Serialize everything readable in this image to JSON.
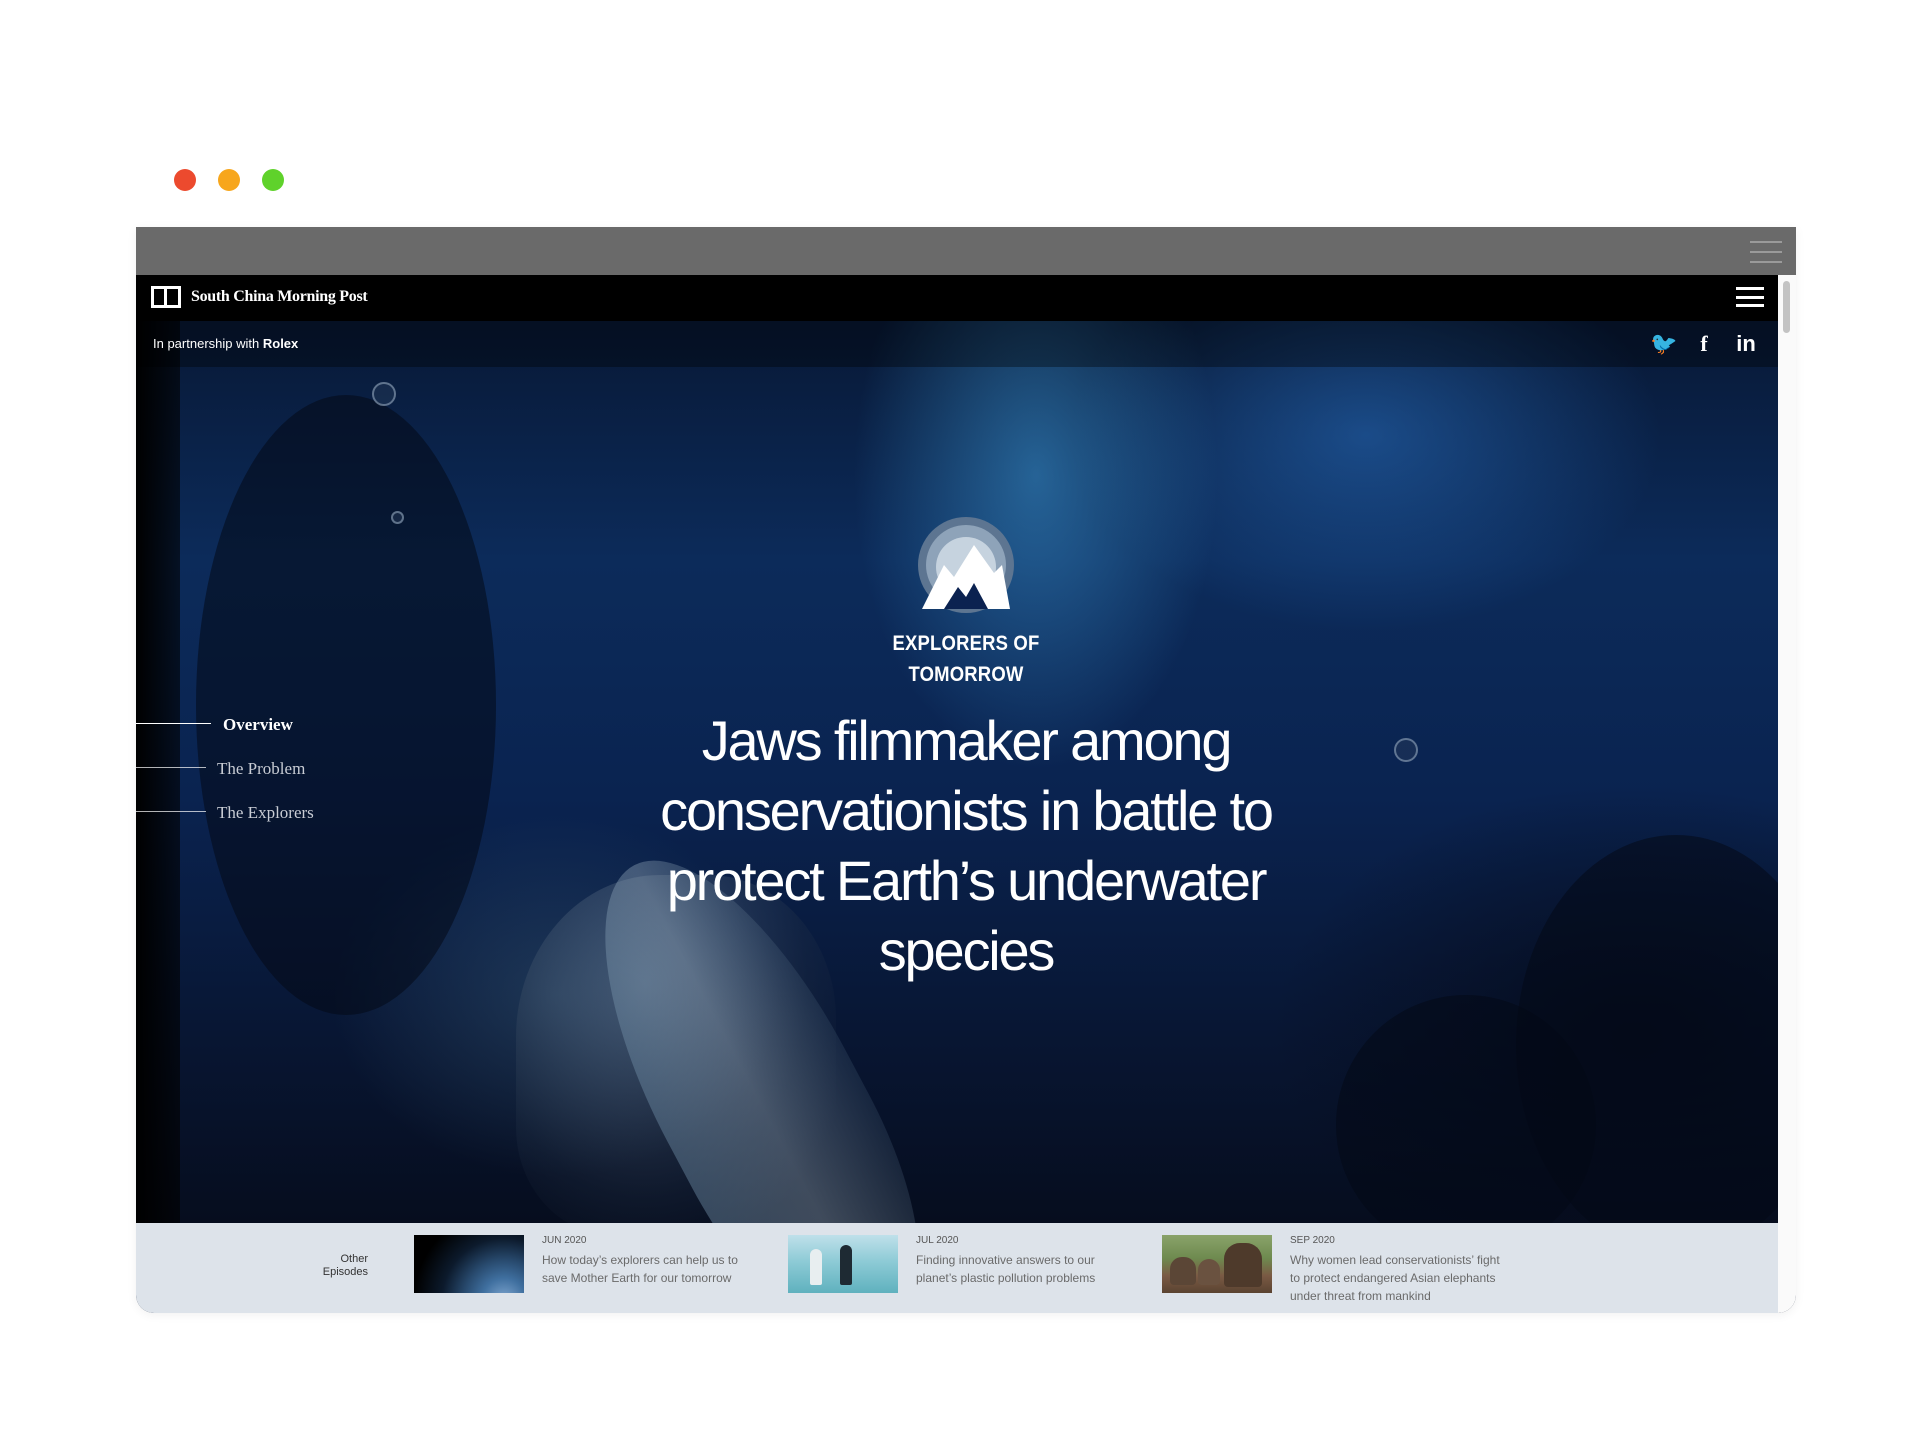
{
  "browser": {
    "traffic_lights": [
      "close",
      "minimize",
      "maximize"
    ],
    "colors": {
      "close": "#ec4a2e",
      "minimize": "#f7a61c",
      "maximize": "#5fd22b"
    }
  },
  "header": {
    "site_name": "South China Morning Post",
    "menu_icon": "hamburger-menu-icon"
  },
  "partner": {
    "prefix": "In partnership with",
    "brand": "Rolex"
  },
  "social": {
    "twitter": "twitter-icon",
    "facebook": "facebook-icon",
    "linkedin": "linkedin-icon",
    "twitter_glyph": "🐦",
    "facebook_glyph": "f",
    "linkedin_glyph": "in"
  },
  "sidenav": {
    "items": [
      {
        "label": "Overview",
        "active": true
      },
      {
        "label": "The Problem",
        "active": false
      },
      {
        "label": "The Explorers",
        "active": false
      }
    ]
  },
  "hero": {
    "series_line1": "EXPLORERS OF",
    "series_line2": "TOMORROW",
    "headline": "Jaws filmmaker among conservationists in battle to protect Earth’s underwater species"
  },
  "episodes": {
    "label_line1": "Other",
    "label_line2": "Episodes",
    "items": [
      {
        "date": "JUN 2020",
        "title": "How today’s explorers can help us to save Mother Earth for our tomorrow",
        "thumb": "earth"
      },
      {
        "date": "JUL 2020",
        "title": "Finding innovative answers to our planet’s plastic pollution problems",
        "thumb": "plastic"
      },
      {
        "date": "SEP 2020",
        "title": "Why women lead conservationists’ fight to protect endangered Asian elephants under threat from mankind",
        "thumb": "elephant"
      }
    ]
  },
  "colors": {
    "background": "#ffffff",
    "chrome": "#6a6a6a",
    "topbar": "#000000",
    "episodes_strip": "#dde3ea"
  }
}
